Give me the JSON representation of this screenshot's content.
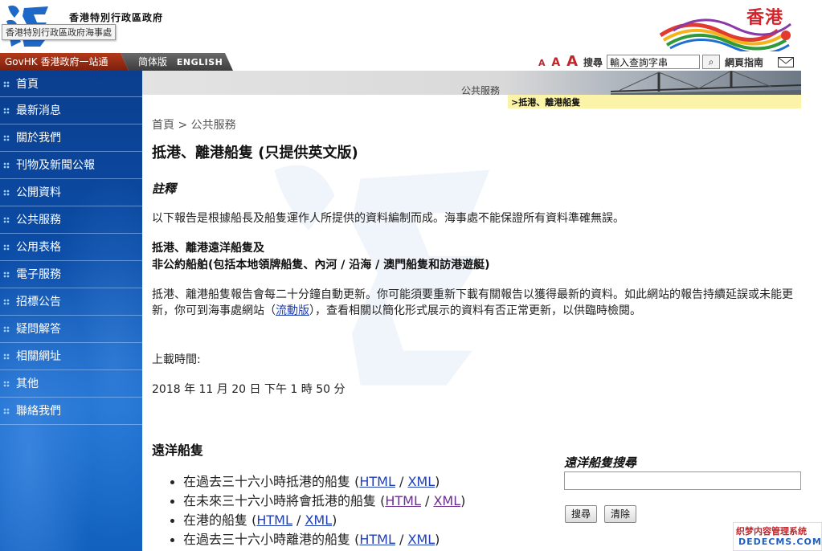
{
  "header": {
    "gov_name": "香港特別行政區政府",
    "tooltip": "香港特別行政區政府海事處",
    "brand_text": "香港"
  },
  "topbar": {
    "govhk": "GovHK 香港政府一站通",
    "lang_simplified": "简体版",
    "lang_english": "ENGLISH",
    "font_small": "A",
    "font_medium": "A",
    "font_large": "A",
    "search_label": "搜尋",
    "search_placeholder": "輸入查詢字串",
    "search_button": "⌕",
    "sitemap": "網頁指南"
  },
  "sidebar": {
    "items": [
      {
        "label": "首頁"
      },
      {
        "label": "最新消息"
      },
      {
        "label": "關於我們"
      },
      {
        "label": "刊物及新聞公報"
      },
      {
        "label": "公開資料"
      },
      {
        "label": "公共服務"
      },
      {
        "label": "公用表格"
      },
      {
        "label": "電子服務"
      },
      {
        "label": "招標公告"
      },
      {
        "label": "疑問解答"
      },
      {
        "label": "相關網址"
      },
      {
        "label": "其他"
      },
      {
        "label": "聯絡我們"
      }
    ]
  },
  "banner": {
    "title": "公共服務",
    "crumb": ">抵港、離港船隻"
  },
  "main": {
    "breadcrumb": "首頁 > 公共服務",
    "title": "抵港、離港船隻 (只提供英文版)",
    "note_heading": "註釋",
    "note_text": "以下報告是根據船長及船隻運作人所提供的資料編制而成。海事處不能保證所有資料準確無誤。",
    "sub_heading_line1": "抵港、離港遠洋船隻及",
    "sub_heading_line2": "非公約船舶(包括本地領牌船隻、內河 / 沿海 / 澳門船隻和訪港遊艇)",
    "update_text_before": "抵港、離港船隻報告會每二十分鐘自動更新。你可能須要重新下載有關報告以獲得最新的資料。如此網站的報告持續延誤或未能更新，你可到海事處網站（",
    "update_link": "流動版",
    "update_text_after": "），查看相關以簡化形式展示的資料有否正常更新，以供臨時檢閱。",
    "upload_label": "上載時間:",
    "upload_time": "2018 年 11 月 20 日 下午 1 時 50 分",
    "section_heading": "遠洋船隻",
    "vessel_links": [
      {
        "text": "在過去三十六小時抵港的船隻 (",
        "html": "HTML",
        "sep": " / ",
        "xml": "XML",
        "end": ")"
      },
      {
        "text": "在未來三十六小時將會抵港的船隻 (",
        "html": "HTML",
        "sep": " / ",
        "xml": "XML",
        "end": ")"
      },
      {
        "text": "在港的船隻 (",
        "html": "HTML",
        "sep": " / ",
        "xml": "XML",
        "end": ")"
      },
      {
        "text": "在過去三十六小時離港的船隻 (",
        "html": "HTML",
        "sep": " / ",
        "xml": "XML",
        "end": ")"
      }
    ]
  },
  "vessel_search": {
    "title": "遠洋船隻搜尋",
    "search_button": "搜尋",
    "clear_button": "清除"
  },
  "badge": {
    "line1": "织梦内容管理系统",
    "line2": "DEDECMS.COM"
  },
  "colors": {
    "accent_red": "#c0262b",
    "sidebar_blue": "#0b4da8",
    "link_blue": "#1f3fb3",
    "crumb_yellow": "#fbf3a8"
  }
}
